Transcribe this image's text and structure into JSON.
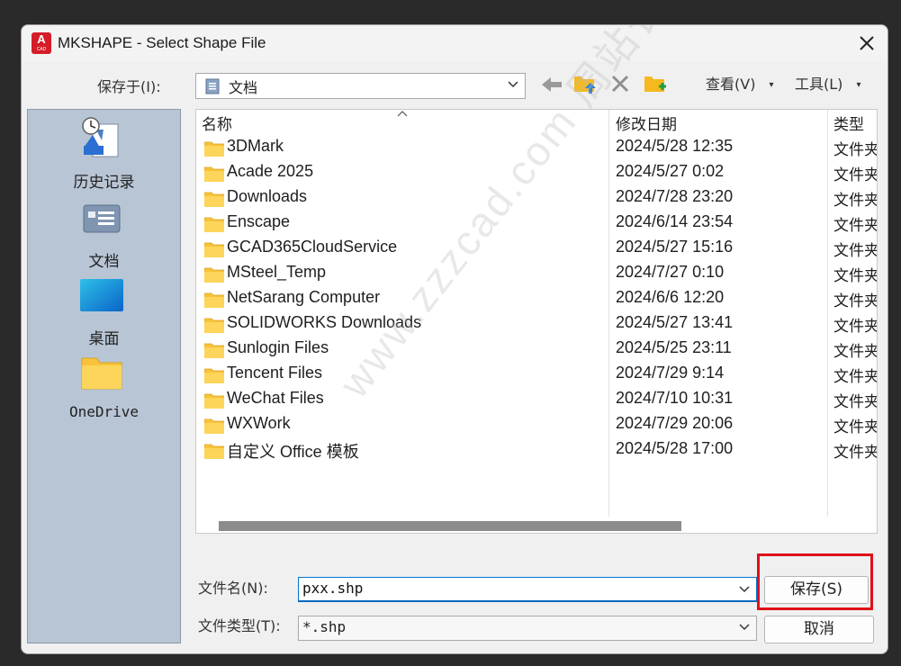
{
  "window": {
    "title": "MKSHAPE - Select Shape File",
    "app_icon_letter": "A",
    "app_icon_sub": "CAD"
  },
  "toolbar": {
    "save_in_label": "保存于(I):",
    "save_in_value": "文档",
    "view_label": "查看(V)",
    "tools_label": "工具(L)",
    "icons": [
      "back-arrow-icon",
      "up-folder-icon",
      "delete-icon",
      "new-folder-icon"
    ]
  },
  "places": [
    {
      "label": "历史记录",
      "icon": "history-icon"
    },
    {
      "label": "文档",
      "icon": "documents-icon"
    },
    {
      "label": "桌面",
      "icon": "desktop-icon"
    },
    {
      "label": "OneDrive",
      "icon": "onedrive-folder-icon"
    }
  ],
  "filelist": {
    "columns": [
      "名称",
      "修改日期",
      "类型"
    ],
    "rows": [
      {
        "name": "3DMark",
        "date": "2024/5/28 12:35",
        "type": "文件夹"
      },
      {
        "name": "Acade 2025",
        "date": "2024/5/27 0:02",
        "type": "文件夹"
      },
      {
        "name": "Downloads",
        "date": "2024/7/28 23:20",
        "type": "文件夹"
      },
      {
        "name": "Enscape",
        "date": "2024/6/14 23:54",
        "type": "文件夹"
      },
      {
        "name": "GCAD365CloudService",
        "date": "2024/5/27 15:16",
        "type": "文件夹"
      },
      {
        "name": "MSteel_Temp",
        "date": "2024/7/27 0:10",
        "type": "文件夹"
      },
      {
        "name": "NetSarang Computer",
        "date": "2024/6/6 12:20",
        "type": "文件夹"
      },
      {
        "name": "SOLIDWORKS Downloads",
        "date": "2024/5/27 13:41",
        "type": "文件夹"
      },
      {
        "name": "Sunlogin Files",
        "date": "2024/5/25 23:11",
        "type": "文件夹"
      },
      {
        "name": "Tencent Files",
        "date": "2024/7/29 9:14",
        "type": "文件夹"
      },
      {
        "name": "WeChat Files",
        "date": "2024/7/10 10:31",
        "type": "文件夹"
      },
      {
        "name": "WXWork",
        "date": "2024/7/29 20:06",
        "type": "文件夹"
      },
      {
        "name": "自定义 Office 模板",
        "date": "2024/5/28 17:00",
        "type": "文件夹"
      }
    ]
  },
  "form": {
    "filename_label": "文件名(N):",
    "filename_value": "pxx.shp",
    "filetype_label": "文件类型(T):",
    "filetype_value": "*.shp",
    "save_button": "保存(S)",
    "cancel_button": "取消"
  },
  "watermark": "www.zzzcad.com 周站长CAD",
  "colors": {
    "highlight": "#e0101a",
    "folder": "#f8c33a",
    "places_bg": "#b8c5d5",
    "accent": "#0078d4"
  }
}
